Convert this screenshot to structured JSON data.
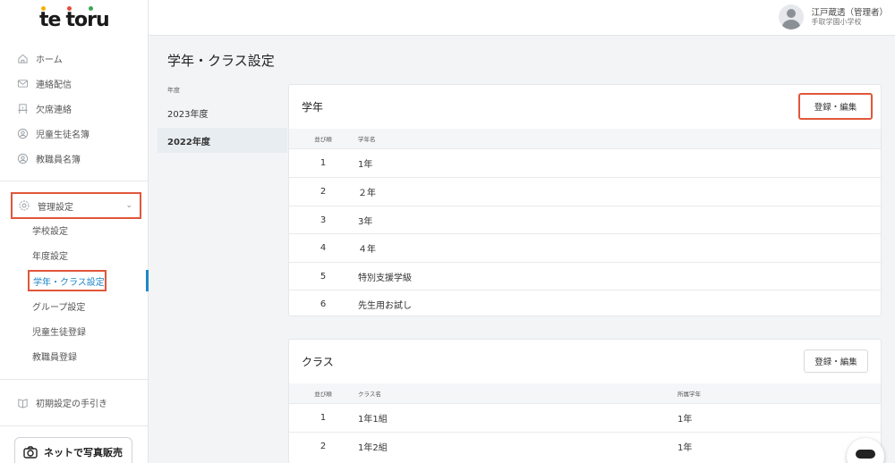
{
  "app": {
    "logo": "tetoru"
  },
  "header": {
    "user_name": "江戸蔵透（管理者）",
    "school": "手取学園小学校"
  },
  "sidebar": {
    "items": [
      {
        "label": "ホーム",
        "icon": "home-icon"
      },
      {
        "label": "連絡配信",
        "icon": "mail-icon"
      },
      {
        "label": "欠席連絡",
        "icon": "absence-icon"
      },
      {
        "label": "児童生徒名簿",
        "icon": "student-roster-icon"
      },
      {
        "label": "教職員名簿",
        "icon": "staff-roster-icon"
      }
    ],
    "admin": {
      "label": "管理設定",
      "icon": "gear-icon"
    },
    "sub_items": [
      "学校設定",
      "年度設定",
      "学年・クラス設定",
      "グループ設定",
      "児童生徒登録",
      "教職員登録"
    ],
    "guide": {
      "label": "初期設定の手引き",
      "icon": "book-icon"
    },
    "promo": {
      "label": "ネットで写真販売"
    }
  },
  "page": {
    "title": "学年・クラス設定"
  },
  "years": {
    "header": "年度",
    "items": [
      "2023年度",
      "2022年度"
    ],
    "selected": "2022年度"
  },
  "grade_card": {
    "title": "学年",
    "edit_label": "登録・編集",
    "columns": [
      "並び順",
      "学年名"
    ],
    "rows": [
      [
        "1",
        "1年"
      ],
      [
        "2",
        "２年"
      ],
      [
        "3",
        "3年"
      ],
      [
        "4",
        "４年"
      ],
      [
        "5",
        "特別支援学級"
      ],
      [
        "6",
        "先生用お試し"
      ]
    ]
  },
  "class_card": {
    "title": "クラス",
    "edit_label": "登録・編集",
    "columns": [
      "並び順",
      "クラス名",
      "所属学年"
    ],
    "rows": [
      [
        "1",
        "1年1組",
        "1年"
      ],
      [
        "2",
        "1年2組",
        "1年"
      ]
    ]
  },
  "colors": {
    "accent": "#1f86c9",
    "highlight": "#e0573a"
  }
}
